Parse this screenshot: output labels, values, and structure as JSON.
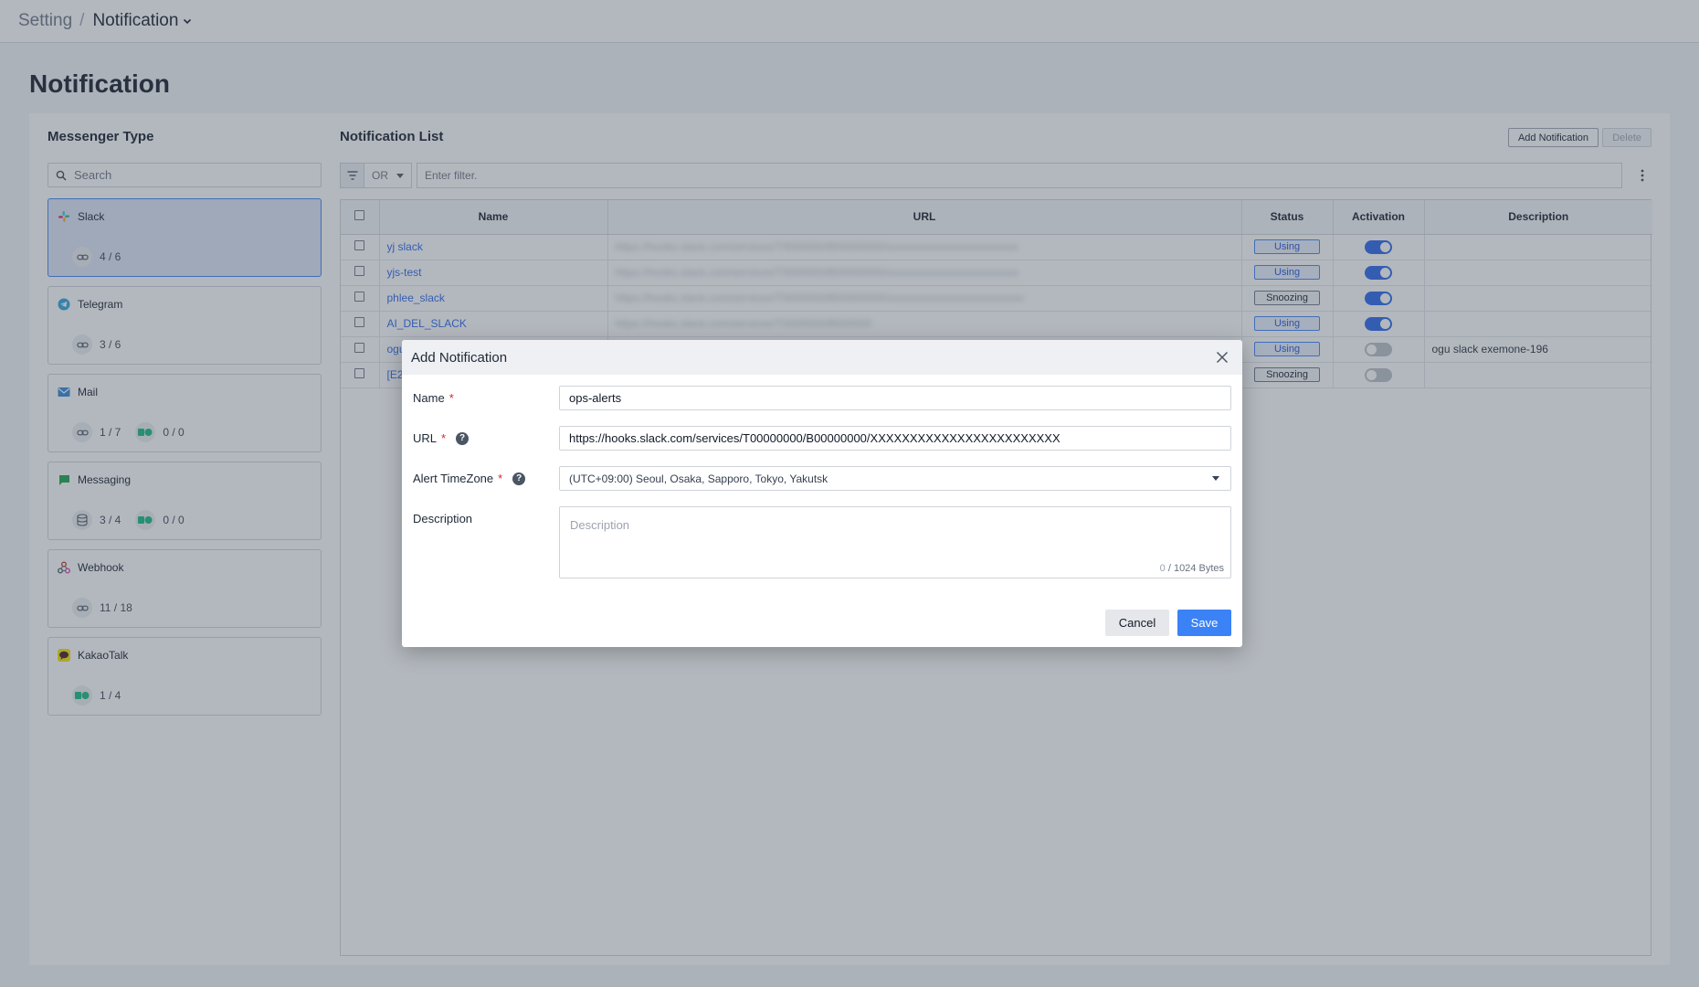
{
  "breadcrumb": {
    "root": "Setting",
    "separator": "/",
    "current": "Notification"
  },
  "page_title": "Notification",
  "messenger": {
    "title": "Messenger Type",
    "search_placeholder": "Search",
    "items": [
      {
        "name": "Slack",
        "icon": "slack-icon",
        "stats": [
          {
            "icon": "link-icon",
            "value": "4 / 6"
          }
        ]
      },
      {
        "name": "Telegram",
        "icon": "telegram-icon",
        "stats": [
          {
            "icon": "link-icon",
            "value": "3 / 6"
          }
        ]
      },
      {
        "name": "Mail",
        "icon": "mail-icon",
        "stats": [
          {
            "icon": "link-icon",
            "value": "1 / 7"
          },
          {
            "icon": "group-icon",
            "value": "0 / 0"
          }
        ]
      },
      {
        "name": "Messaging",
        "icon": "chat-icon",
        "stats": [
          {
            "icon": "database-icon",
            "value": "3 / 4"
          },
          {
            "icon": "group-icon",
            "value": "0 / 0"
          }
        ]
      },
      {
        "name": "Webhook",
        "icon": "webhook-icon",
        "stats": [
          {
            "icon": "link-icon",
            "value": "11 / 18"
          }
        ]
      },
      {
        "name": "KakaoTalk",
        "icon": "kakaotalk-icon",
        "stats": [
          {
            "icon": "group-icon",
            "value": "1 / 4"
          }
        ]
      }
    ]
  },
  "list": {
    "title": "Notification List",
    "add_label": "Add Notification",
    "delete_label": "Delete",
    "filter_operator": "OR",
    "filter_placeholder": "Enter filter.",
    "columns": {
      "name": "Name",
      "url": "URL",
      "status": "Status",
      "activation": "Activation",
      "description": "Description"
    },
    "rows": [
      {
        "name": "yj slack",
        "url": "https://hooks.slack.com/services/T0000000/B00000000/xxxxxxxxxxxxxxxxxxxxxxxx",
        "status": "Using",
        "active": true,
        "description": ""
      },
      {
        "name": "yjs-test",
        "url": "https://hooks.slack.com/services/T0000000/B00000000/xxxxxxxxxxxxxxxxxxxxxxxx",
        "status": "Using",
        "active": true,
        "description": ""
      },
      {
        "name": "phlee_slack",
        "url": "https://hooks.slack.com/services/T0000000/B00000000/xxxxxxxxxxxxxxxxxxxxxxxxx",
        "status": "Snoozing",
        "active": true,
        "description": ""
      },
      {
        "name": "AI_DEL_SLACK",
        "url": "https://hooks.slack.com/services/T0000000/B000000",
        "status": "Using",
        "active": true,
        "description": ""
      },
      {
        "name": "ogu",
        "url": "",
        "status": "Using",
        "active": false,
        "description": "ogu slack exemone-196"
      },
      {
        "name": "[E2",
        "url": "",
        "status": "Snoozing",
        "active": false,
        "description": ""
      }
    ]
  },
  "modal": {
    "title": "Add Notification",
    "name_label": "Name",
    "name_value": "ops-alerts",
    "url_label": "URL",
    "url_value": "https://hooks.slack.com/services/T00000000/B00000000/XXXXXXXXXXXXXXXXXXXXXXXX",
    "tz_label": "Alert TimeZone",
    "tz_value": "(UTC+09:00) Seoul, Osaka, Sapporo, Tokyo, Yakutsk",
    "desc_label": "Description",
    "desc_placeholder": "Description",
    "bytes_used": "0",
    "bytes_total": " / 1024 Bytes",
    "required_mark": "*",
    "help_mark": "?",
    "cancel_label": "Cancel",
    "save_label": "Save"
  },
  "colors": {
    "accent": "#3b82f6",
    "link": "#2563eb",
    "required": "#dc2626"
  }
}
